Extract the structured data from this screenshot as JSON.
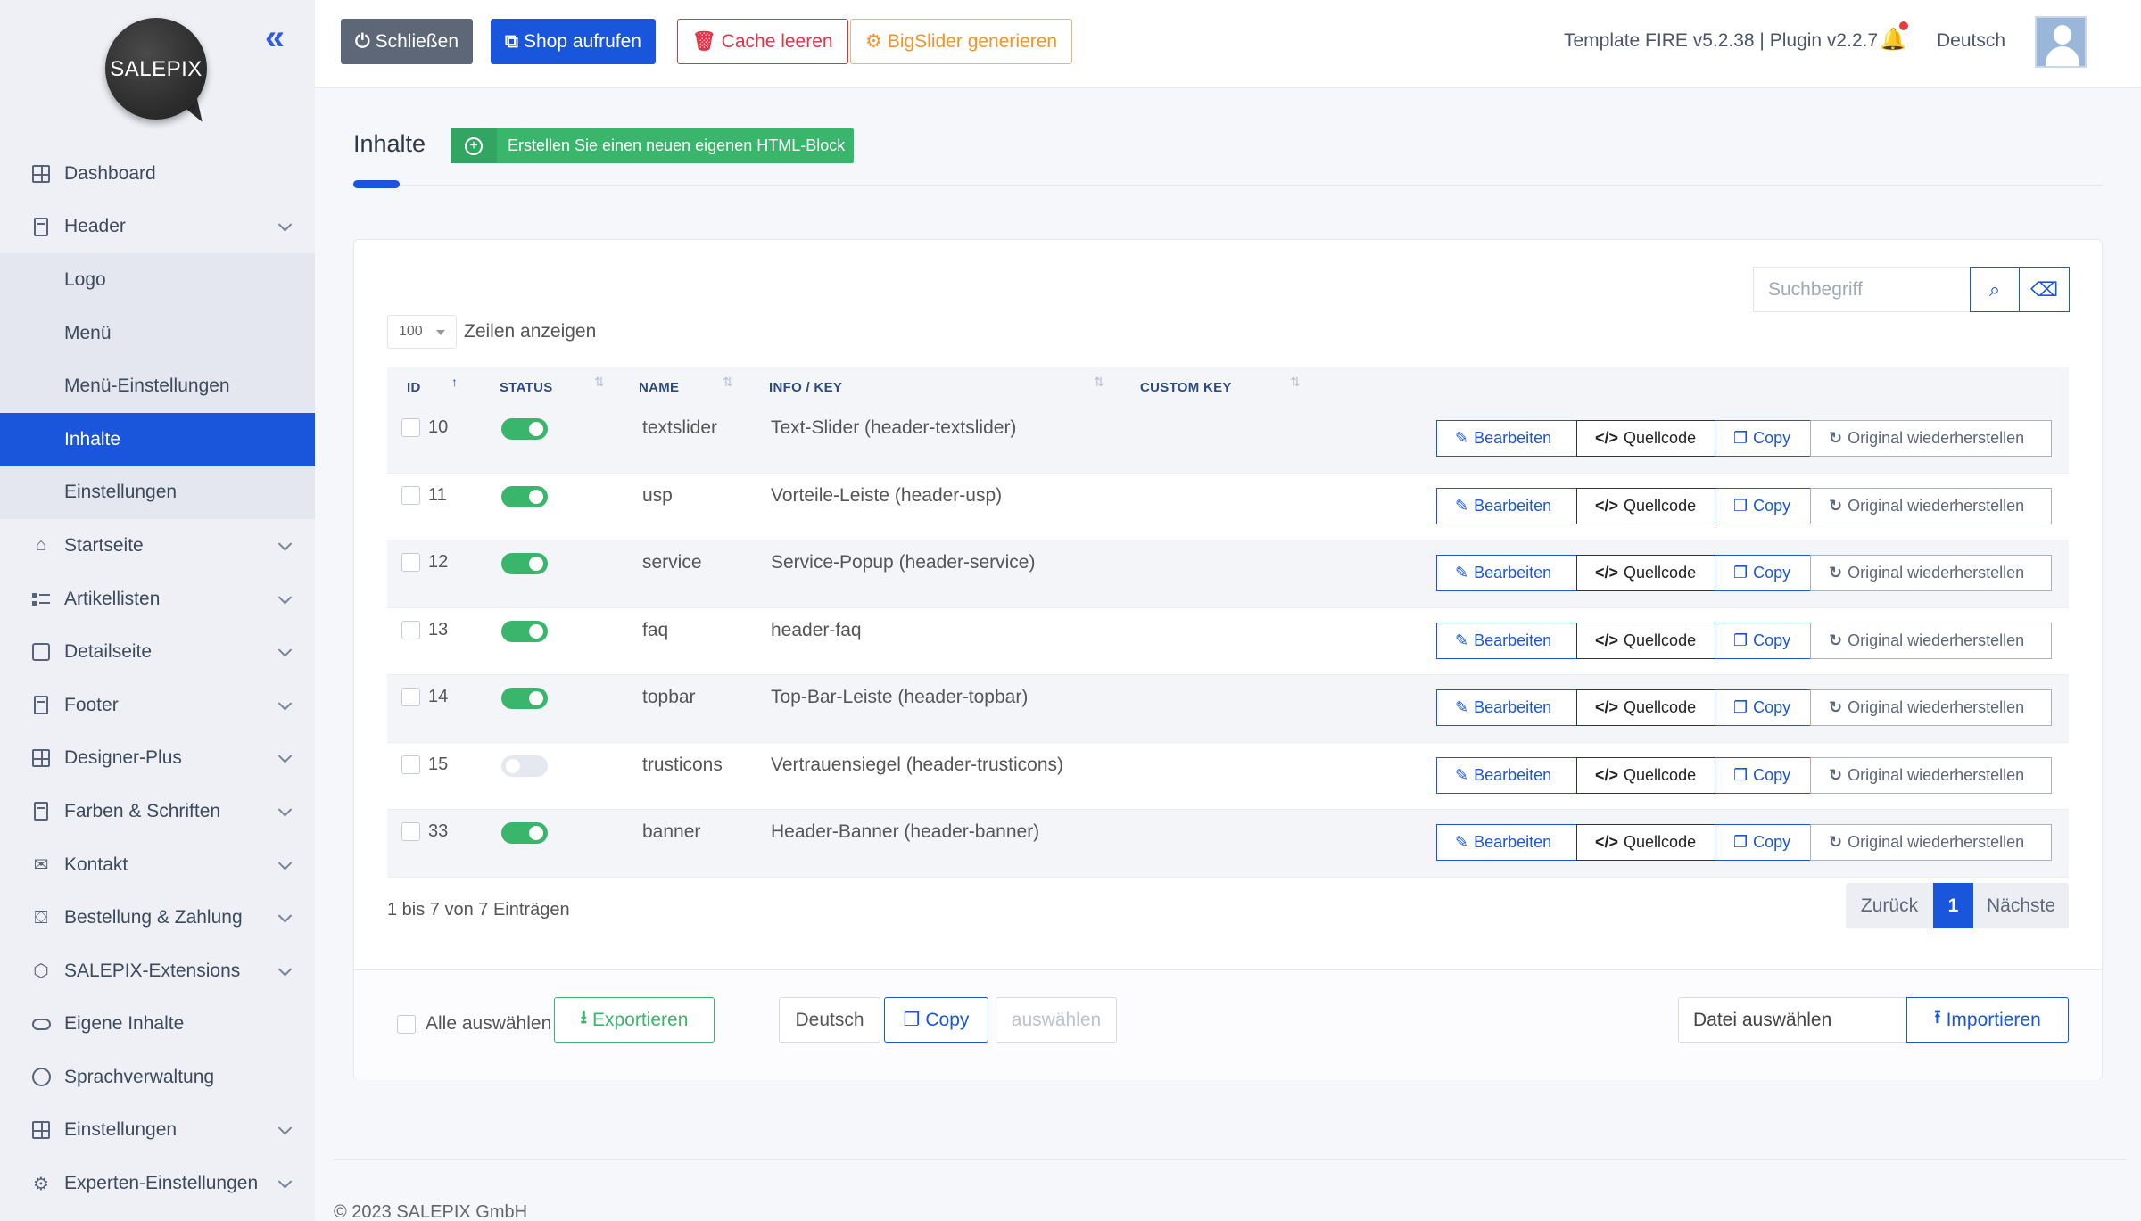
{
  "sidebar": {
    "logo_text": "SALEPIX",
    "collapse_icon": "double-chevron-left-icon",
    "items": [
      {
        "label": "Dashboard",
        "icon": "grid-icon"
      },
      {
        "label": "Header",
        "icon": "box-icon",
        "sub": [
          "Logo",
          "Menü",
          "Menü-Einstellungen",
          "Inhalte",
          "Einstellungen"
        ],
        "active_sub": "Inhalte"
      },
      {
        "label": "Startseite",
        "icon": "home-icon"
      },
      {
        "label": "Artikellisten",
        "icon": "list-icon"
      },
      {
        "label": "Detailseite",
        "icon": "doc-icon"
      },
      {
        "label": "Footer",
        "icon": "doc-icon"
      },
      {
        "label": "Designer-Plus",
        "icon": "grid-icon"
      },
      {
        "label": "Farben & Schriften",
        "icon": "brush-icon"
      },
      {
        "label": "Kontakt",
        "icon": "mail-icon"
      },
      {
        "label": "Bestellung & Zahlung",
        "icon": "cart-icon"
      },
      {
        "label": "SALEPIX-Extensions",
        "icon": "cube-icon"
      },
      {
        "label": "Eigene Inhalte",
        "icon": "toggle-icon"
      },
      {
        "label": "Sprachverwaltung",
        "icon": "globe-icon"
      },
      {
        "label": "Einstellungen",
        "icon": "grid-icon"
      },
      {
        "label": "Experten-Einstellungen",
        "icon": "gear-icon"
      }
    ]
  },
  "topbar": {
    "close_label": "Schließen",
    "shop_label": "Shop aufrufen",
    "cache_label": "Cache leeren",
    "bigslider_label": "BigSlider generieren",
    "version_text": "Template FIRE v5.2.38 | Plugin v2.2.7",
    "language": "Deutsch"
  },
  "page": {
    "title": "Inhalte",
    "create_label": "Erstellen Sie einen neuen eigenen HTML-Block"
  },
  "table": {
    "search_placeholder": "Suchbegriff",
    "page_length": "100",
    "page_length_label": "Zeilen anzeigen",
    "columns": [
      "ID",
      "STATUS",
      "NAME",
      "INFO / KEY",
      "CUSTOM KEY"
    ],
    "rows": [
      {
        "id": "10",
        "status": true,
        "name": "textslider",
        "info": "Text-Slider (header-textslider)"
      },
      {
        "id": "11",
        "status": true,
        "name": "usp",
        "info": "Vorteile-Leiste (header-usp)"
      },
      {
        "id": "12",
        "status": true,
        "name": "service",
        "info": "Service-Popup (header-service)"
      },
      {
        "id": "13",
        "status": true,
        "name": "faq",
        "info": "header-faq"
      },
      {
        "id": "14",
        "status": true,
        "name": "topbar",
        "info": "Top-Bar-Leiste (header-topbar)"
      },
      {
        "id": "15",
        "status": false,
        "name": "trusticons",
        "info": "Vertrauensiegel (header-trusticons)"
      },
      {
        "id": "33",
        "status": true,
        "name": "banner",
        "info": "Header-Banner (header-banner)"
      }
    ],
    "actions": {
      "edit": "Bearbeiten",
      "source": "Quellcode",
      "copy": "Copy",
      "restore": "Original wiederherstellen"
    },
    "info_text": "1 bis 7 von 7 Einträgen",
    "pager": {
      "prev": "Zurück",
      "current": "1",
      "next": "Nächste"
    }
  },
  "footer_bar": {
    "select_all": "Alle auswählen",
    "export": "Exportieren",
    "language": "Deutsch",
    "copy": "Copy",
    "select": "auswählen",
    "file": "Datei auswählen",
    "import": "Importieren"
  },
  "copyright": "© 2023 SALEPIX GmbH",
  "colors": {
    "primary": "#1a56db",
    "success": "#3ab56c",
    "danger": "#dc3545",
    "warning": "#f0932b",
    "sidebar_bg": "#eef0f6"
  }
}
